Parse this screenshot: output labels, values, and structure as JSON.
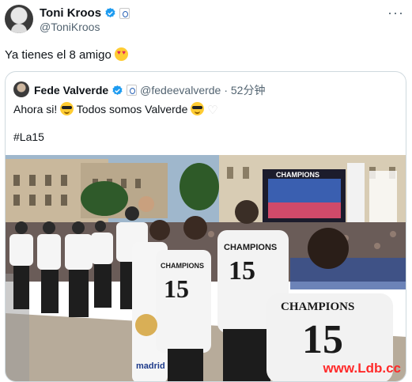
{
  "author": {
    "name": "Toni Kroos",
    "handle": "@ToniKroos"
  },
  "tweet": {
    "text": "Ya tienes el 8 amigo"
  },
  "quoted": {
    "name": "Fede Valverde",
    "handle": "@fedeevalverde",
    "time": "· 52分钟",
    "text": "Ahora si!",
    "text2": "Todos somos Valverde",
    "hashtag": "#La15"
  },
  "photo": {
    "screen_banner": "CHAMPIONS",
    "shirt_text": "CHAMPIONS",
    "shirt_number": "15",
    "sponsor": "madrid",
    "watermark": "www.Ldb.cc"
  },
  "icons": {
    "more": "more-dots-icon",
    "verified": "verified-badge-icon"
  },
  "colors": {
    "verified": "#1d9bf0",
    "muted": "#536471",
    "border": "#cfd9de"
  }
}
